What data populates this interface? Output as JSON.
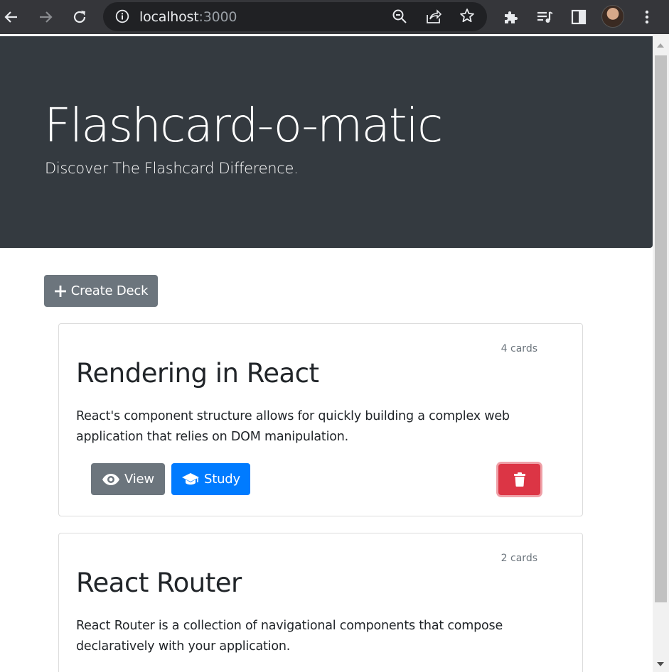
{
  "browser": {
    "url_host": "localhost",
    "url_port": ":3000"
  },
  "header": {
    "title": "Flashcard-o-matic",
    "subtitle": "Discover The Flashcard Difference."
  },
  "actions": {
    "create_deck_label": "Create Deck"
  },
  "decks": [
    {
      "count": "4 cards",
      "title": "Rendering in React",
      "description": "React's component structure allows for quickly building a complex web application that relies on DOM manipulation.",
      "view_label": "View",
      "study_label": "Study"
    },
    {
      "count": "2 cards",
      "title": "React Router",
      "description": "React Router is a collection of navigational components that compose declaratively with your application."
    }
  ],
  "colors": {
    "header_bg": "#343a40",
    "secondary": "#6c757d",
    "primary": "#007bff",
    "danger": "#dc3545"
  }
}
